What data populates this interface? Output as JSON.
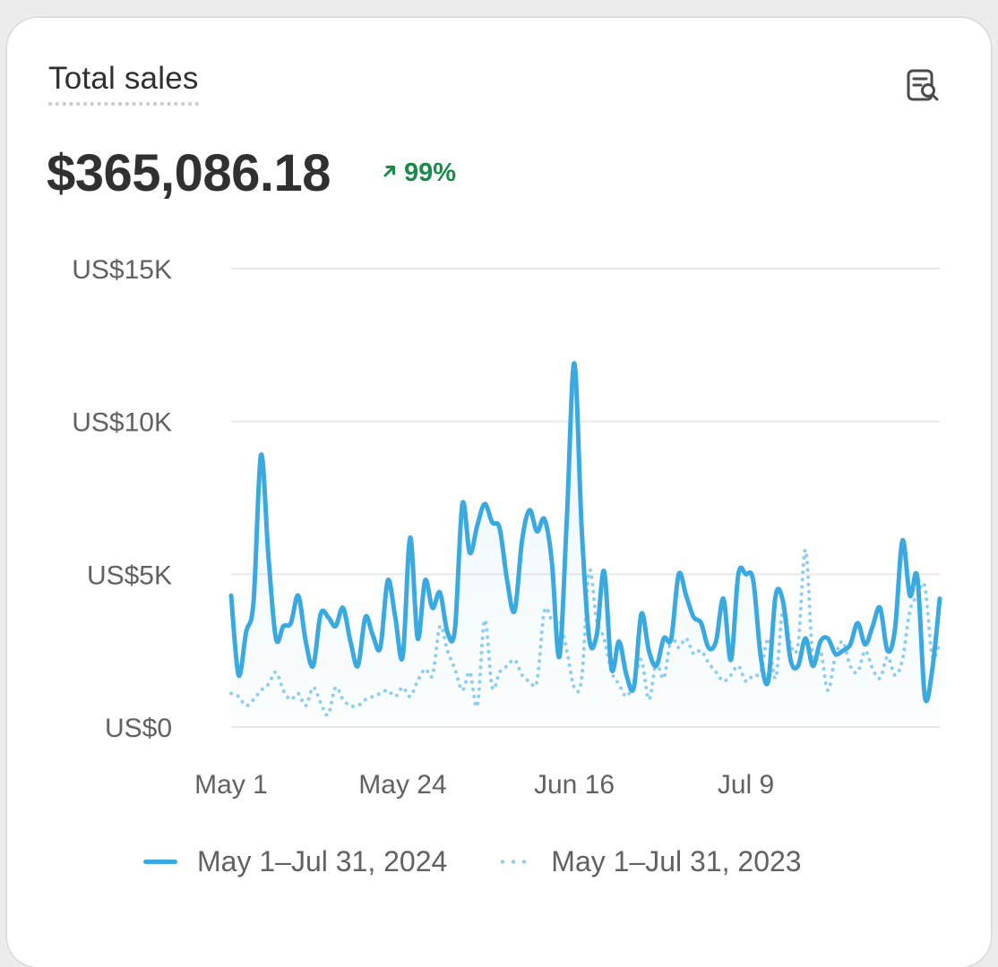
{
  "card": {
    "title": "Total sales",
    "value": "$365,086.18",
    "delta": "99%",
    "delta_color": "#1a8a4a",
    "report_icon": "report-search-icon",
    "delta_icon": "arrow-up-right-icon"
  },
  "colors": {
    "current": "#3aa9e0",
    "previous": "#8fcdf0",
    "grid": "#e8e8e8",
    "axis_text": "#616161"
  },
  "legend": [
    {
      "label": "May 1–Jul 31, 2024",
      "style": "solid"
    },
    {
      "label": "May 1–Jul 31, 2023",
      "style": "dotted"
    }
  ],
  "chart_data": {
    "type": "line",
    "title": "Total sales",
    "xlabel": "",
    "ylabel": "",
    "ylim": [
      0,
      15000
    ],
    "y_ticks": [
      0,
      5000,
      10000,
      15000
    ],
    "y_tick_labels": [
      "US$0",
      "US$5K",
      "US$10K",
      "US$15K"
    ],
    "x_tick_labels": [
      "May 1",
      "May 24",
      "Jun 16",
      "Jul 9"
    ],
    "x_tick_index": [
      0,
      23,
      46,
      69
    ],
    "grid": true,
    "legend_position": "bottom",
    "series": [
      {
        "name": "May 1–Jul 31, 2024",
        "style": "solid",
        "values": [
          4300,
          1700,
          3100,
          4100,
          8900,
          5600,
          2900,
          3300,
          3400,
          4300,
          2800,
          2000,
          3700,
          3600,
          3300,
          3900,
          2800,
          2000,
          3600,
          3000,
          2600,
          4800,
          3600,
          2300,
          6200,
          2900,
          4800,
          3900,
          4400,
          3100,
          3200,
          7300,
          5700,
          6600,
          7300,
          6700,
          6500,
          4800,
          3800,
          6100,
          7100,
          6400,
          6800,
          5400,
          2300,
          6800,
          11900,
          6500,
          2900,
          3000,
          5100,
          1900,
          2800,
          1700,
          1300,
          3700,
          2500,
          2000,
          2900,
          2900,
          5000,
          4300,
          3600,
          3400,
          2600,
          2800,
          4200,
          2200,
          5000,
          5000,
          4800,
          2300,
          1500,
          4300,
          4100,
          2200,
          2000,
          2900,
          2000,
          2800,
          2900,
          2400,
          2500,
          2700,
          3400,
          2700,
          3300,
          3900,
          2500,
          3200,
          6100,
          4300,
          4900,
          1000,
          1900,
          4200
        ]
      },
      {
        "name": "May 1–Jul 31, 2023",
        "style": "dotted",
        "values": [
          1100,
          1000,
          700,
          900,
          1200,
          1400,
          1800,
          1200,
          900,
          1100,
          700,
          1300,
          800,
          400,
          1300,
          900,
          700,
          700,
          900,
          1000,
          1100,
          1200,
          1000,
          1300,
          1000,
          1500,
          1900,
          1700,
          3300,
          2500,
          1900,
          1200,
          1800,
          700,
          3500,
          1300,
          1800,
          2000,
          2200,
          1700,
          1500,
          1500,
          3800,
          3500,
          3500,
          2500,
          1300,
          1600,
          5100,
          3500,
          2900,
          1800,
          1400,
          1000,
          1500,
          2200,
          900,
          2100,
          1600,
          2900,
          2600,
          2900,
          2400,
          2500,
          2100,
          1800,
          1500,
          1700,
          2000,
          1500,
          1700,
          1800,
          2900,
          1600,
          3900,
          2700,
          2700,
          5800,
          2200,
          2500,
          1200,
          2300,
          2800,
          2000,
          1800,
          2500,
          1900,
          1600,
          2300,
          1700,
          2200,
          3800,
          4300,
          4600,
          2300,
          2800
        ]
      }
    ]
  }
}
